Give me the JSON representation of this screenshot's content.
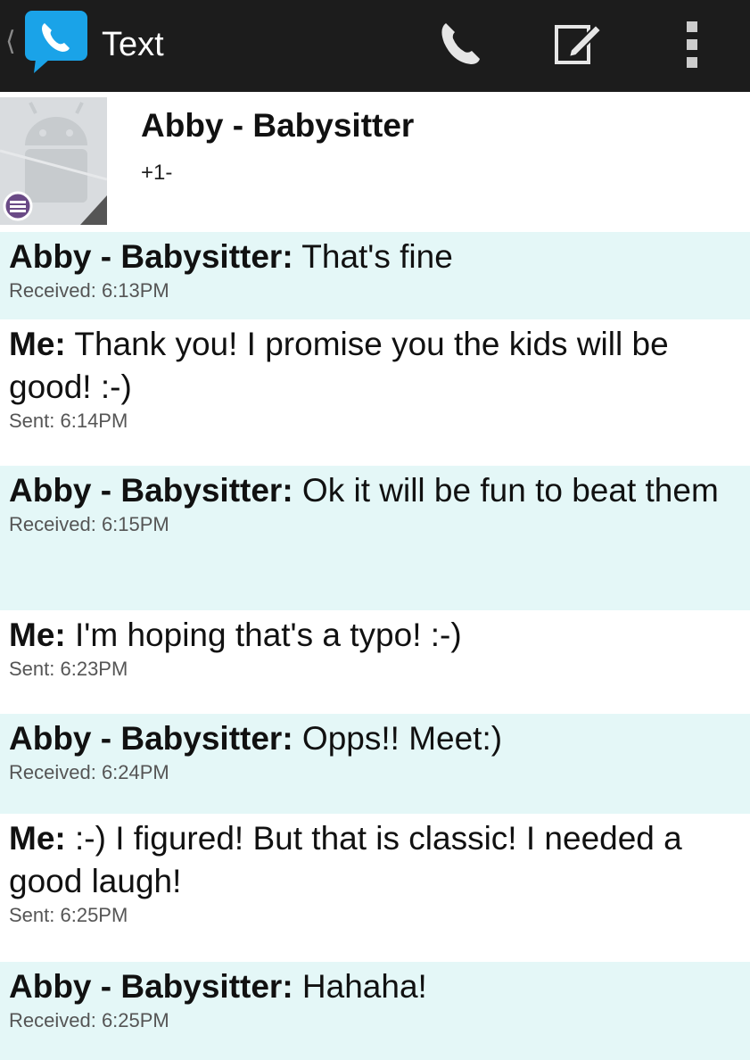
{
  "app": {
    "title": "Text",
    "logo_icon": "chat-bubble-phone-icon",
    "back_icon": "chevron-left-icon"
  },
  "toolbar": {
    "call_icon": "phone-icon",
    "compose_icon": "compose-icon",
    "menu_icon": "overflow-menu-icon"
  },
  "contact": {
    "name": "Abby - Babysitter",
    "number": "+1-",
    "avatar_icon": "android-avatar-icon",
    "badge_icon": "message-badge-icon"
  },
  "messages": [
    {
      "sender": "Abby - Babysitter:",
      "text": " That's fine",
      "meta": "Received: 6:13PM",
      "direction": "received"
    },
    {
      "sender": "Me:",
      "text": " Thank you! I promise you the kids will be good! :-)",
      "meta": "Sent: 6:14PM",
      "direction": "sent"
    },
    {
      "sender": "Abby - Babysitter:",
      "text": " Ok it will be fun to beat them",
      "meta": "Received: 6:15PM",
      "direction": "received"
    },
    {
      "sender": "Me:",
      "text": " I'm hoping that's a typo! :-)",
      "meta": "Sent: 6:23PM",
      "direction": "sent"
    },
    {
      "sender": "Abby - Babysitter:",
      "text": " Opps!! Meet:)",
      "meta": "Received: 6:24PM",
      "direction": "received"
    },
    {
      "sender": "Me:",
      "text": " :-)  I figured! But that is classic! I needed a good laugh!",
      "meta": "Sent: 6:25PM",
      "direction": "sent"
    },
    {
      "sender": "Abby - Babysitter:",
      "text": " Hahaha!",
      "meta": "Received: 6:25PM",
      "direction": "received"
    }
  ],
  "colors": {
    "topbar": "#1c1c1c",
    "received_bg": "#e4f7f7",
    "sent_bg": "#ffffff",
    "logo_blue": "#1aa3e8"
  }
}
